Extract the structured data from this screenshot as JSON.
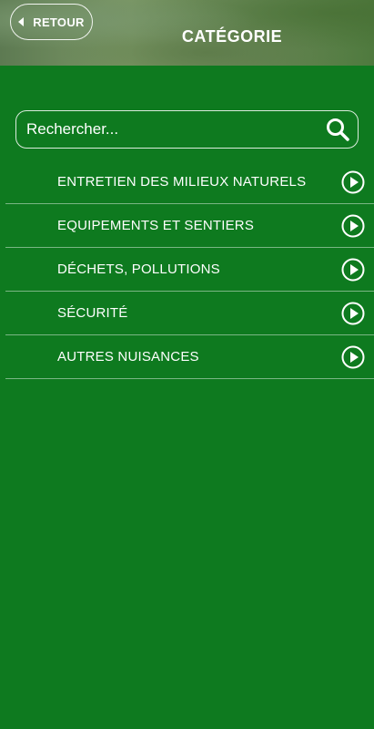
{
  "header": {
    "back_label": "RETOUR",
    "title": "CATÉGORIE"
  },
  "search": {
    "placeholder": "Rechercher..."
  },
  "categories": [
    {
      "label": "ENTRETIEN DES MILIEUX NATURELS"
    },
    {
      "label": "EQUIPEMENTS ET SENTIERS"
    },
    {
      "label": "DÉCHETS, POLLUTIONS"
    },
    {
      "label": "SÉCURITÉ"
    },
    {
      "label": "AUTRES NUISANCES"
    }
  ],
  "theme": {
    "background": "#0e7a1f",
    "text": "#ffffff"
  },
  "icons": {
    "back": "caret-left-icon",
    "search": "search-icon",
    "row_arrow": "play-circle-icon"
  }
}
